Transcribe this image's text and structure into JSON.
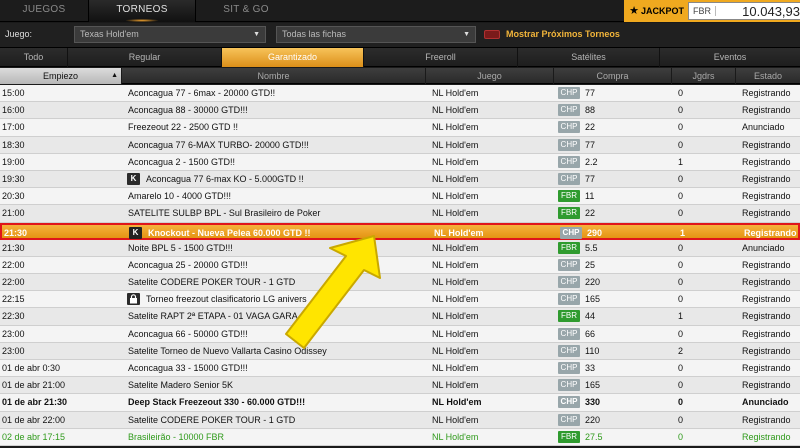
{
  "nav": {
    "tabs": [
      {
        "label": "JUEGOS"
      },
      {
        "label": "TORNEOS",
        "active": true
      },
      {
        "label": "SIT & GO"
      }
    ]
  },
  "jackpot": {
    "icon": "star-icon",
    "label": "JACKPOT",
    "currency": "FBR",
    "value": "10.043,93"
  },
  "filters": {
    "game_label": "Juego:",
    "game_value": "Texas Hold'em",
    "chips_value": "Todas las fichas",
    "show_next_label": "Mostrar Próximos Torneos"
  },
  "categories": [
    {
      "label": "Todo"
    },
    {
      "label": "Regular"
    },
    {
      "label": "Garantizado",
      "active": true
    },
    {
      "label": "Freeroll"
    },
    {
      "label": "Satélites"
    },
    {
      "label": "Eventos"
    }
  ],
  "columns": {
    "start": "Empiezo",
    "name": "Nombre",
    "game": "Juego",
    "buyin": "Compra",
    "players": "Jgdrs",
    "status": "Estado"
  },
  "rows": [
    {
      "start": "15:00",
      "name": "Aconcagua 77 - 6max - 20000 GTD!!",
      "game": "NL Hold'em",
      "cur": "CHP",
      "buy": "77",
      "plr": "0",
      "status": "Registrando"
    },
    {
      "start": "16:00",
      "name": "Aconcagua 88 - 30000 GTD!!!",
      "game": "NL Hold'em",
      "cur": "CHP",
      "buy": "88",
      "plr": "0",
      "status": "Registrando"
    },
    {
      "start": "17:00",
      "name": "Freezeout 22 - 2500 GTD !!",
      "game": "NL Hold'em",
      "cur": "CHP",
      "buy": "22",
      "plr": "0",
      "status": "Anunciado"
    },
    {
      "start": "18:30",
      "name": "Aconcagua 77 6-MAX TURBO- 20000 GTD!!!",
      "game": "NL Hold'em",
      "cur": "CHP",
      "buy": "77",
      "plr": "0",
      "status": "Registrando"
    },
    {
      "start": "19:00",
      "name": "Aconcagua 2 - 1500 GTD!!",
      "game": "NL Hold'em",
      "cur": "CHP",
      "buy": "2.2",
      "plr": "1",
      "status": "Registrando"
    },
    {
      "start": "19:30",
      "name": "Aconcagua 77  6-max KO - 5.000GTD !!",
      "icon": "K",
      "game": "NL Hold'em",
      "cur": "CHP",
      "buy": "77",
      "plr": "0",
      "status": "Registrando"
    },
    {
      "start": "20:30",
      "name": "Amarelo 10 - 4000 GTD!!!",
      "game": "NL Hold'em",
      "cur": "FBR",
      "buy": "11",
      "plr": "0",
      "status": "Registrando"
    },
    {
      "start": "21:00",
      "name": "SATELITE SULBP BPL - Sul Brasileiro de Poker",
      "game": "NL Hold'em",
      "cur": "FBR",
      "buy": "22",
      "plr": "0",
      "status": "Registrando"
    },
    {
      "start": "21:30",
      "name": "Knockout - Nueva Pelea 60.000 GTD !!",
      "icon": "K",
      "game": "NL Hold'em",
      "cur": "CHP",
      "buy": "290",
      "plr": "1",
      "status": "Registrando",
      "selected": true
    },
    {
      "start": "21:30",
      "name": "Noite BPL 5 - 1500 GTD!!!",
      "game": "NL Hold'em",
      "cur": "FBR",
      "buy": "5.5",
      "plr": "0",
      "status": "Anunciado"
    },
    {
      "start": "22:00",
      "name": "Aconcagua 25 - 20000 GTD!!!",
      "game": "NL Hold'em",
      "cur": "CHP",
      "buy": "25",
      "plr": "0",
      "status": "Registrando"
    },
    {
      "start": "22:00",
      "name": "Satelite CODERE POKER TOUR - 1 GTD",
      "game": "NL Hold'em",
      "cur": "CHP",
      "buy": "220",
      "plr": "0",
      "status": "Registrando"
    },
    {
      "start": "22:15",
      "name": "Torneo freezout clasificatorio LG anivers",
      "icon": "lock",
      "game": "NL Hold'em",
      "cur": "CHP",
      "buy": "165",
      "plr": "0",
      "status": "Registrando"
    },
    {
      "start": "22:30",
      "name": "Satelite RAPT 2ª ETAPA - 01 VAGA GARA...",
      "game": "NL Hold'em",
      "cur": "FBR",
      "buy": "44",
      "plr": "1",
      "status": "Registrando"
    },
    {
      "start": "23:00",
      "name": "Aconcagua 66 - 50000 GTD!!!",
      "game": "NL Hold'em",
      "cur": "CHP",
      "buy": "66",
      "plr": "0",
      "status": "Registrando"
    },
    {
      "start": "23:00",
      "name": "Satelite Torneo de Nuevo Vallarta Casino Odissey",
      "game": "NL Hold'em",
      "cur": "CHP",
      "buy": "110",
      "plr": "2",
      "status": "Registrando"
    },
    {
      "start": "01 de abr 0:30",
      "name": "Aconcagua 33 - 15000 GTD!!!",
      "game": "NL Hold'em",
      "cur": "CHP",
      "buy": "33",
      "plr": "0",
      "status": "Registrando"
    },
    {
      "start": "01 de abr 21:00",
      "name": "Satelite Madero Senior 5K",
      "game": "NL Hold'em",
      "cur": "CHP",
      "buy": "165",
      "plr": "0",
      "status": "Registrando"
    },
    {
      "start": "01 de abr 21:30",
      "name": "Deep Stack Freezeout 330 - 60.000 GTD!!!",
      "game": "NL Hold'em",
      "cur": "CHP",
      "buy": "330",
      "plr": "0",
      "status": "Anunciado",
      "bold": true
    },
    {
      "start": "01 de abr 22:00",
      "name": "Satelite CODERE POKER TOUR - 1 GTD",
      "game": "NL Hold'em",
      "cur": "CHP",
      "buy": "220",
      "plr": "0",
      "status": "Registrando"
    },
    {
      "start": "02 de abr 17:15",
      "name": "Brasileirão - 10000 FBR",
      "game": "NL Hold'em",
      "cur": "FBR",
      "buy": "27.5",
      "plr": "0",
      "status": "Registrando",
      "green": true
    }
  ]
}
